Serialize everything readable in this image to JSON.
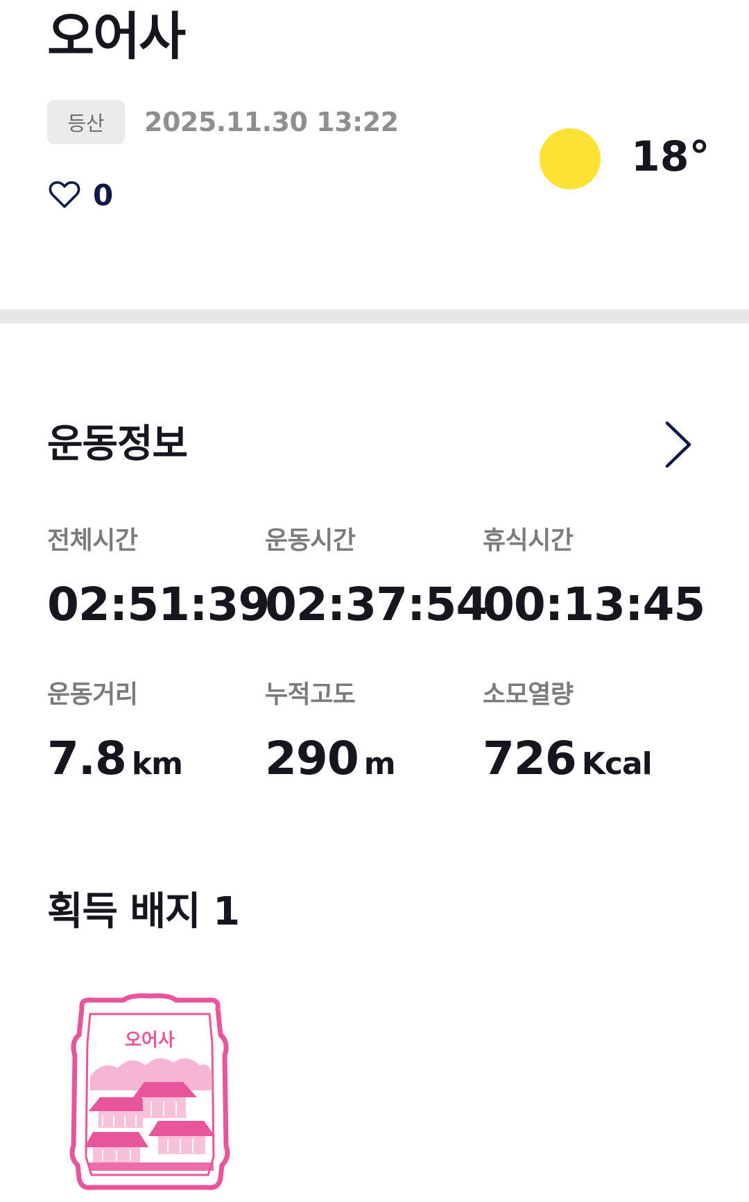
{
  "header": {
    "title": "오어사",
    "category_tag": "등산",
    "datetime": "2025.11.30 13:22",
    "like_count": "0",
    "like_icon": "heart-outline-icon",
    "weather_icon": "sun-icon",
    "weather_color": "#FCE232",
    "temperature": "18°"
  },
  "exercise": {
    "title": "운동정보",
    "more_icon": "chevron-right-icon",
    "stats_row1": [
      {
        "label": "전체시간",
        "value": "02:51:39"
      },
      {
        "label": "운동시간",
        "value": "02:37:54"
      },
      {
        "label": "휴식시간",
        "value": "00:13:45"
      }
    ],
    "stats_row2": [
      {
        "label": "운동거리",
        "value": "7.8",
        "unit": "km"
      },
      {
        "label": "누적고도",
        "value": "290",
        "unit": "m"
      },
      {
        "label": "소모열량",
        "value": "726",
        "unit": "Kcal"
      }
    ]
  },
  "badges": {
    "title": "획득 배지 1",
    "items": [
      {
        "name": "오어사",
        "color": "#E8559B"
      }
    ]
  }
}
